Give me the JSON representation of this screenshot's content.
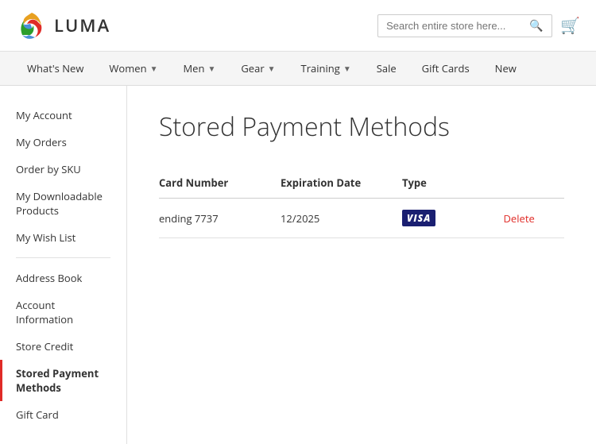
{
  "header": {
    "logo_text": "LUMA",
    "search_placeholder": "Search entire store here...",
    "cart_icon": "🛒"
  },
  "nav": {
    "items": [
      {
        "label": "What's New",
        "has_dropdown": false
      },
      {
        "label": "Women",
        "has_dropdown": true
      },
      {
        "label": "Men",
        "has_dropdown": true
      },
      {
        "label": "Gear",
        "has_dropdown": true
      },
      {
        "label": "Training",
        "has_dropdown": true
      },
      {
        "label": "Sale",
        "has_dropdown": false
      },
      {
        "label": "Gift Cards",
        "has_dropdown": false
      },
      {
        "label": "New",
        "has_dropdown": false
      }
    ]
  },
  "sidebar": {
    "items": [
      {
        "label": "My Account",
        "active": false,
        "id": "my-account"
      },
      {
        "label": "My Orders",
        "active": false,
        "id": "my-orders"
      },
      {
        "label": "Order by SKU",
        "active": false,
        "id": "order-by-sku"
      },
      {
        "label": "My Downloadable Products",
        "active": false,
        "id": "my-downloadable-products"
      },
      {
        "label": "My Wish List",
        "active": false,
        "id": "my-wish-list"
      },
      {
        "label": "Address Book",
        "active": false,
        "id": "address-book"
      },
      {
        "label": "Account Information",
        "active": false,
        "id": "account-information"
      },
      {
        "label": "Store Credit",
        "active": false,
        "id": "store-credit"
      },
      {
        "label": "Stored Payment Methods",
        "active": true,
        "id": "stored-payment-methods"
      },
      {
        "label": "Gift Card",
        "active": false,
        "id": "gift-card"
      }
    ]
  },
  "page": {
    "title": "Stored Payment Methods",
    "table": {
      "columns": [
        {
          "label": "Card Number",
          "key": "card_number"
        },
        {
          "label": "Expiration Date",
          "key": "expiration_date"
        },
        {
          "label": "Type",
          "key": "type"
        },
        {
          "label": "",
          "key": "action"
        }
      ],
      "rows": [
        {
          "card_number": "ending 7737",
          "expiration_date": "12/2025",
          "type": "VISA",
          "action": "Delete"
        }
      ]
    }
  }
}
